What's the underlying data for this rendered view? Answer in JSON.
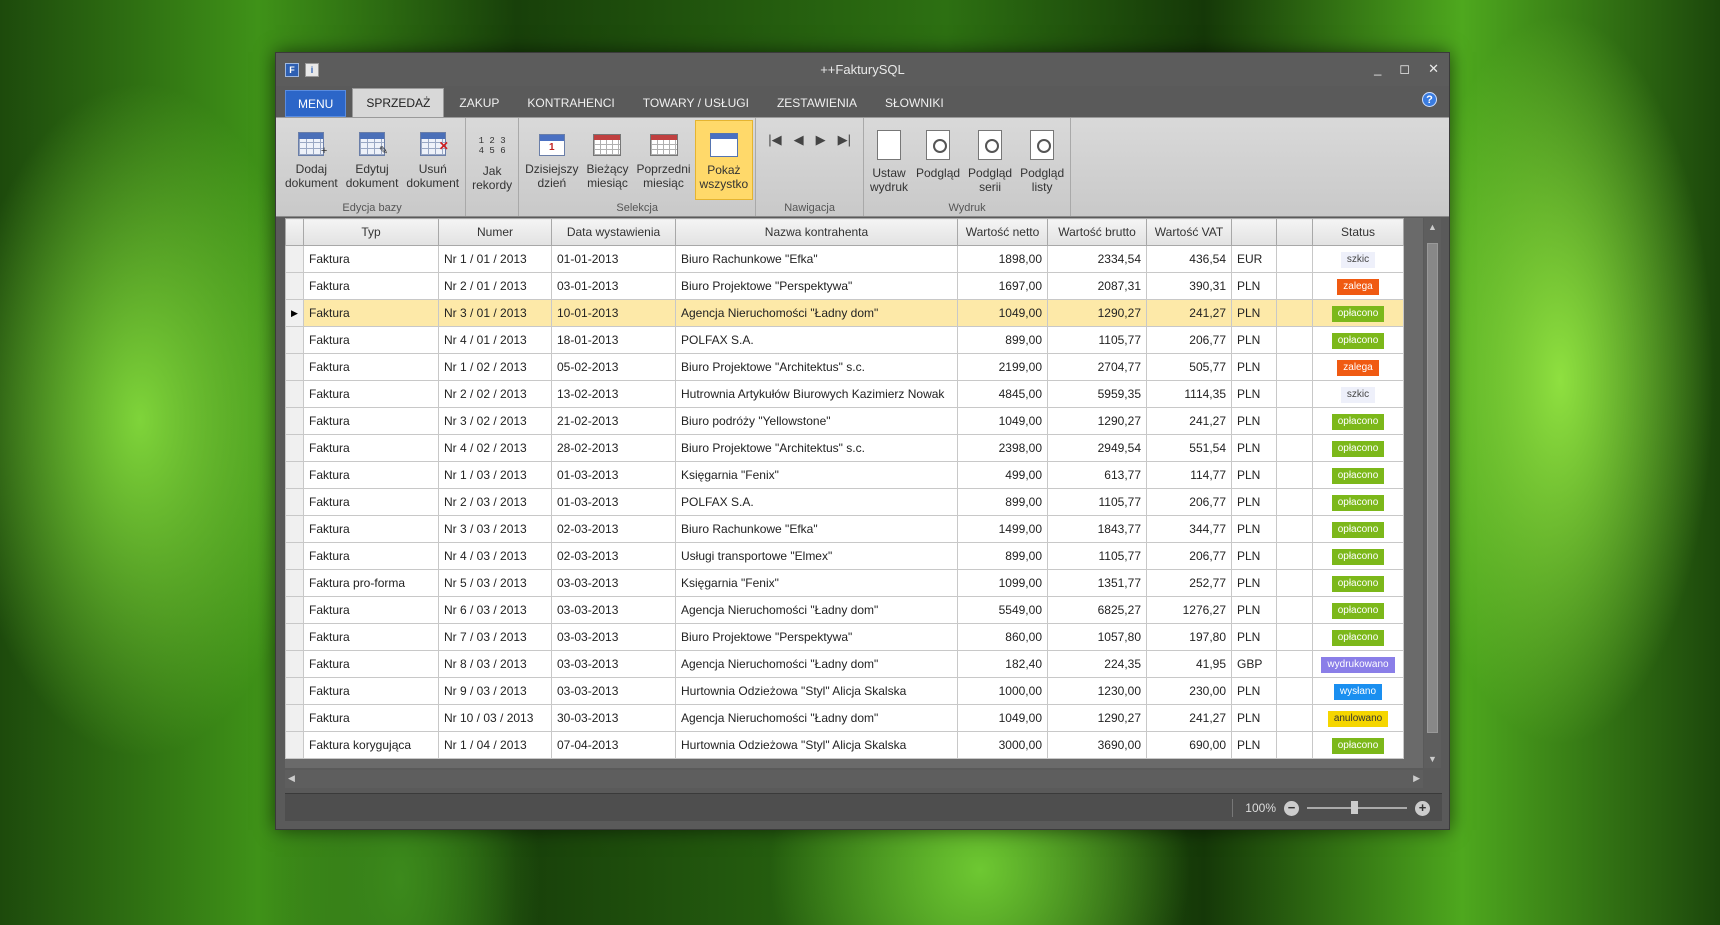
{
  "window": {
    "title": "++FakturySQL",
    "minimize": "_",
    "maximize": "◻",
    "close": "✕",
    "help": "?"
  },
  "tabs": {
    "menu": "MENU",
    "items": [
      "SPRZEDAŻ",
      "ZAKUP",
      "KONTRAHENCI",
      "TOWARY / USŁUGI",
      "ZESTAWIENIA",
      "SŁOWNIKI"
    ],
    "active": "SPRZEDAŻ"
  },
  "ribbon": {
    "groups": {
      "edycja": {
        "label": "Edycja bazy",
        "buttons": [
          {
            "label": "Dodaj\ndokument",
            "icon": "add-grid-icon"
          },
          {
            "label": "Edytuj\ndokument",
            "icon": "edit-grid-icon"
          },
          {
            "label": "Usuń\ndokument",
            "icon": "delete-grid-icon"
          }
        ]
      },
      "jak": {
        "label": "",
        "buttons": [
          {
            "label": "Jak\nrekordy",
            "icon": "records-icon"
          }
        ]
      },
      "selekcja": {
        "label": "Selekcja",
        "buttons": [
          {
            "label": "Dzisiejszy\ndzień",
            "icon": "today-calendar-icon"
          },
          {
            "label": "Bieżący\nmiesiąc",
            "icon": "current-month-icon"
          },
          {
            "label": "Poprzedni\nmiesiąc",
            "icon": "previous-month-icon"
          },
          {
            "label": "Pokaż\nwszystko",
            "icon": "show-all-icon"
          }
        ]
      },
      "nawigacja": {
        "label": "Nawigacja",
        "buttons": [
          "|◀",
          "◀",
          "▶",
          "▶|"
        ]
      },
      "wydruk": {
        "label": "Wydruk",
        "buttons": [
          {
            "label": "Ustaw\nwydruk",
            "icon": "page-setup-icon"
          },
          {
            "label": "Podgląd",
            "icon": "preview-icon"
          },
          {
            "label": "Podgląd\nserii",
            "icon": "preview-series-icon"
          },
          {
            "label": "Podgląd\nlisty",
            "icon": "preview-list-icon"
          }
        ]
      }
    }
  },
  "table": {
    "headers": [
      "Typ",
      "Numer",
      "Data wystawienia",
      "Nazwa kontrahenta",
      "Wartość netto",
      "Wartość brutto",
      "Wartość VAT",
      "",
      "",
      "Status"
    ],
    "selected_row": 2,
    "rows": [
      [
        "Faktura",
        "Nr 1 / 01 / 2013",
        "01-01-2013",
        "Biuro Rachunkowe \"Efka\"",
        "1898,00",
        "2334,54",
        "436,54",
        "EUR",
        "",
        "szkic"
      ],
      [
        "Faktura",
        "Nr 2 / 01 / 2013",
        "03-01-2013",
        "Biuro Projektowe \"Perspektywa\"",
        "1697,00",
        "2087,31",
        "390,31",
        "PLN",
        "",
        "zalega"
      ],
      [
        "Faktura",
        "Nr 3 / 01 / 2013",
        "10-01-2013",
        "Agencja Nieruchomości \"Ładny dom\"",
        "1049,00",
        "1290,27",
        "241,27",
        "PLN",
        "",
        "opłacono"
      ],
      [
        "Faktura",
        "Nr 4 / 01 / 2013",
        "18-01-2013",
        "POLFAX S.A.",
        "899,00",
        "1105,77",
        "206,77",
        "PLN",
        "",
        "opłacono"
      ],
      [
        "Faktura",
        "Nr 1 / 02 / 2013",
        "05-02-2013",
        "Biuro Projektowe \"Architektus\" s.c.",
        "2199,00",
        "2704,77",
        "505,77",
        "PLN",
        "",
        "zalega"
      ],
      [
        "Faktura",
        "Nr 2 / 02 / 2013",
        "13-02-2013",
        "Hutrownia Artykułów Biurowych Kazimierz Nowak",
        "4845,00",
        "5959,35",
        "1114,35",
        "PLN",
        "",
        "szkic"
      ],
      [
        "Faktura",
        "Nr 3 / 02 / 2013",
        "21-02-2013",
        "Biuro podróży \"Yellowstone\"",
        "1049,00",
        "1290,27",
        "241,27",
        "PLN",
        "",
        "opłacono"
      ],
      [
        "Faktura",
        "Nr 4 / 02 / 2013",
        "28-02-2013",
        "Biuro Projektowe \"Architektus\" s.c.",
        "2398,00",
        "2949,54",
        "551,54",
        "PLN",
        "",
        "opłacono"
      ],
      [
        "Faktura",
        "Nr 1 / 03 / 2013",
        "01-03-2013",
        "Księgarnia \"Fenix\"",
        "499,00",
        "613,77",
        "114,77",
        "PLN",
        "",
        "opłacono"
      ],
      [
        "Faktura",
        "Nr 2 / 03 / 2013",
        "01-03-2013",
        "POLFAX S.A.",
        "899,00",
        "1105,77",
        "206,77",
        "PLN",
        "",
        "opłacono"
      ],
      [
        "Faktura",
        "Nr 3 / 03 / 2013",
        "02-03-2013",
        "Biuro Rachunkowe \"Efka\"",
        "1499,00",
        "1843,77",
        "344,77",
        "PLN",
        "",
        "opłacono"
      ],
      [
        "Faktura",
        "Nr 4 / 03 / 2013",
        "02-03-2013",
        "Usługi transportowe \"Elmex\"",
        "899,00",
        "1105,77",
        "206,77",
        "PLN",
        "",
        "opłacono"
      ],
      [
        "Faktura pro-forma",
        "Nr 5 / 03 / 2013",
        "03-03-2013",
        "Księgarnia \"Fenix\"",
        "1099,00",
        "1351,77",
        "252,77",
        "PLN",
        "",
        "opłacono"
      ],
      [
        "Faktura",
        "Nr 6 / 03 / 2013",
        "03-03-2013",
        "Agencja Nieruchomości \"Ładny dom\"",
        "5549,00",
        "6825,27",
        "1276,27",
        "PLN",
        "",
        "opłacono"
      ],
      [
        "Faktura",
        "Nr 7 / 03 / 2013",
        "03-03-2013",
        "Biuro Projektowe \"Perspektywa\"",
        "860,00",
        "1057,80",
        "197,80",
        "PLN",
        "",
        "opłacono"
      ],
      [
        "Faktura",
        "Nr 8 / 03 / 2013",
        "03-03-2013",
        "Agencja Nieruchomości \"Ładny dom\"",
        "182,40",
        "224,35",
        "41,95",
        "GBP",
        "",
        "wydrukowano"
      ],
      [
        "Faktura",
        "Nr 9 / 03 / 2013",
        "03-03-2013",
        "Hurtownia Odzieżowa \"Styl\" Alicja Skalska",
        "1000,00",
        "1230,00",
        "230,00",
        "PLN",
        "",
        "wysłano"
      ],
      [
        "Faktura",
        "Nr 10 / 03 / 2013",
        "30-03-2013",
        "Agencja Nieruchomości \"Ładny dom\"",
        "1049,00",
        "1290,27",
        "241,27",
        "PLN",
        "",
        "anulowano"
      ],
      [
        "Faktura korygująca",
        "Nr 1 / 04 / 2013",
        "07-04-2013",
        "Hurtownia Odzieżowa \"Styl\" Alicja Skalska",
        "3000,00",
        "3690,00",
        "690,00",
        "PLN",
        "",
        "opłacono"
      ]
    ],
    "status_colors": {
      "szkic": {
        "bg": "#eef0fa",
        "fg": "#444444"
      },
      "zalega": {
        "bg": "#f05a12",
        "fg": "#ffffff"
      },
      "opłacono": {
        "bg": "#7cb81a",
        "fg": "#ffffff"
      },
      "wydrukowano": {
        "bg": "#8a7ee8",
        "fg": "#ffffff"
      },
      "wysłano": {
        "bg": "#1a8ff0",
        "fg": "#ffffff"
      },
      "anulowano": {
        "bg": "#f5d600",
        "fg": "#333333"
      }
    }
  },
  "statusbar": {
    "zoom": "100%",
    "zoom_out": "−",
    "zoom_in": "+"
  }
}
